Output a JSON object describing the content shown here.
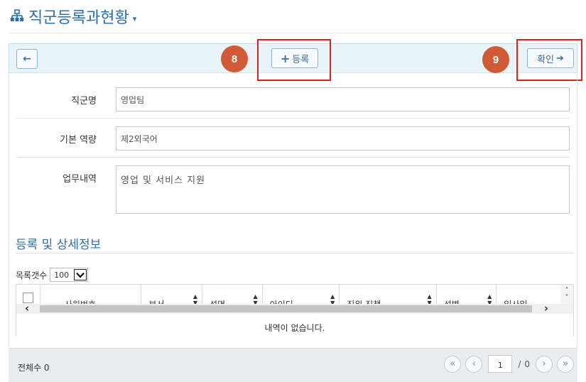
{
  "page": {
    "title": "직군등록과현황",
    "title_caret": "▾"
  },
  "toolbar": {
    "back_icon": "←",
    "add_icon": "+",
    "add_label": "등록",
    "confirm_label": "확인",
    "confirm_icon": "➔"
  },
  "markers": {
    "m8": "8",
    "m9": "9"
  },
  "form": {
    "job_group_name": {
      "label": "직군명",
      "value": "영업팀"
    },
    "basic_competency": {
      "label": "기본 역량",
      "value": "제2외국어"
    },
    "duties": {
      "label": "업무내역",
      "value": "영업 및 서비스 지원"
    }
  },
  "section": {
    "title": "등록 및 상세정보"
  },
  "list": {
    "per_page_label": "목록갯수",
    "per_page_value": "100",
    "columns": [
      "사원번호",
      "부서",
      "성명",
      "아이디",
      "직위 직책",
      "성별",
      "입사일"
    ],
    "empty_message": "내역이 없습니다."
  },
  "footer": {
    "total_label": "전체수 0",
    "current_page": "1",
    "slash": "/",
    "total_pages": "0",
    "first_icon": "«",
    "prev_icon": "‹",
    "next_icon": "›",
    "last_icon": "»"
  },
  "colors": {
    "accent": "#2a6fb0",
    "toolbar_bg": "#e8f3fa",
    "marker": "#cf5a35",
    "highlight": "#e02020"
  }
}
